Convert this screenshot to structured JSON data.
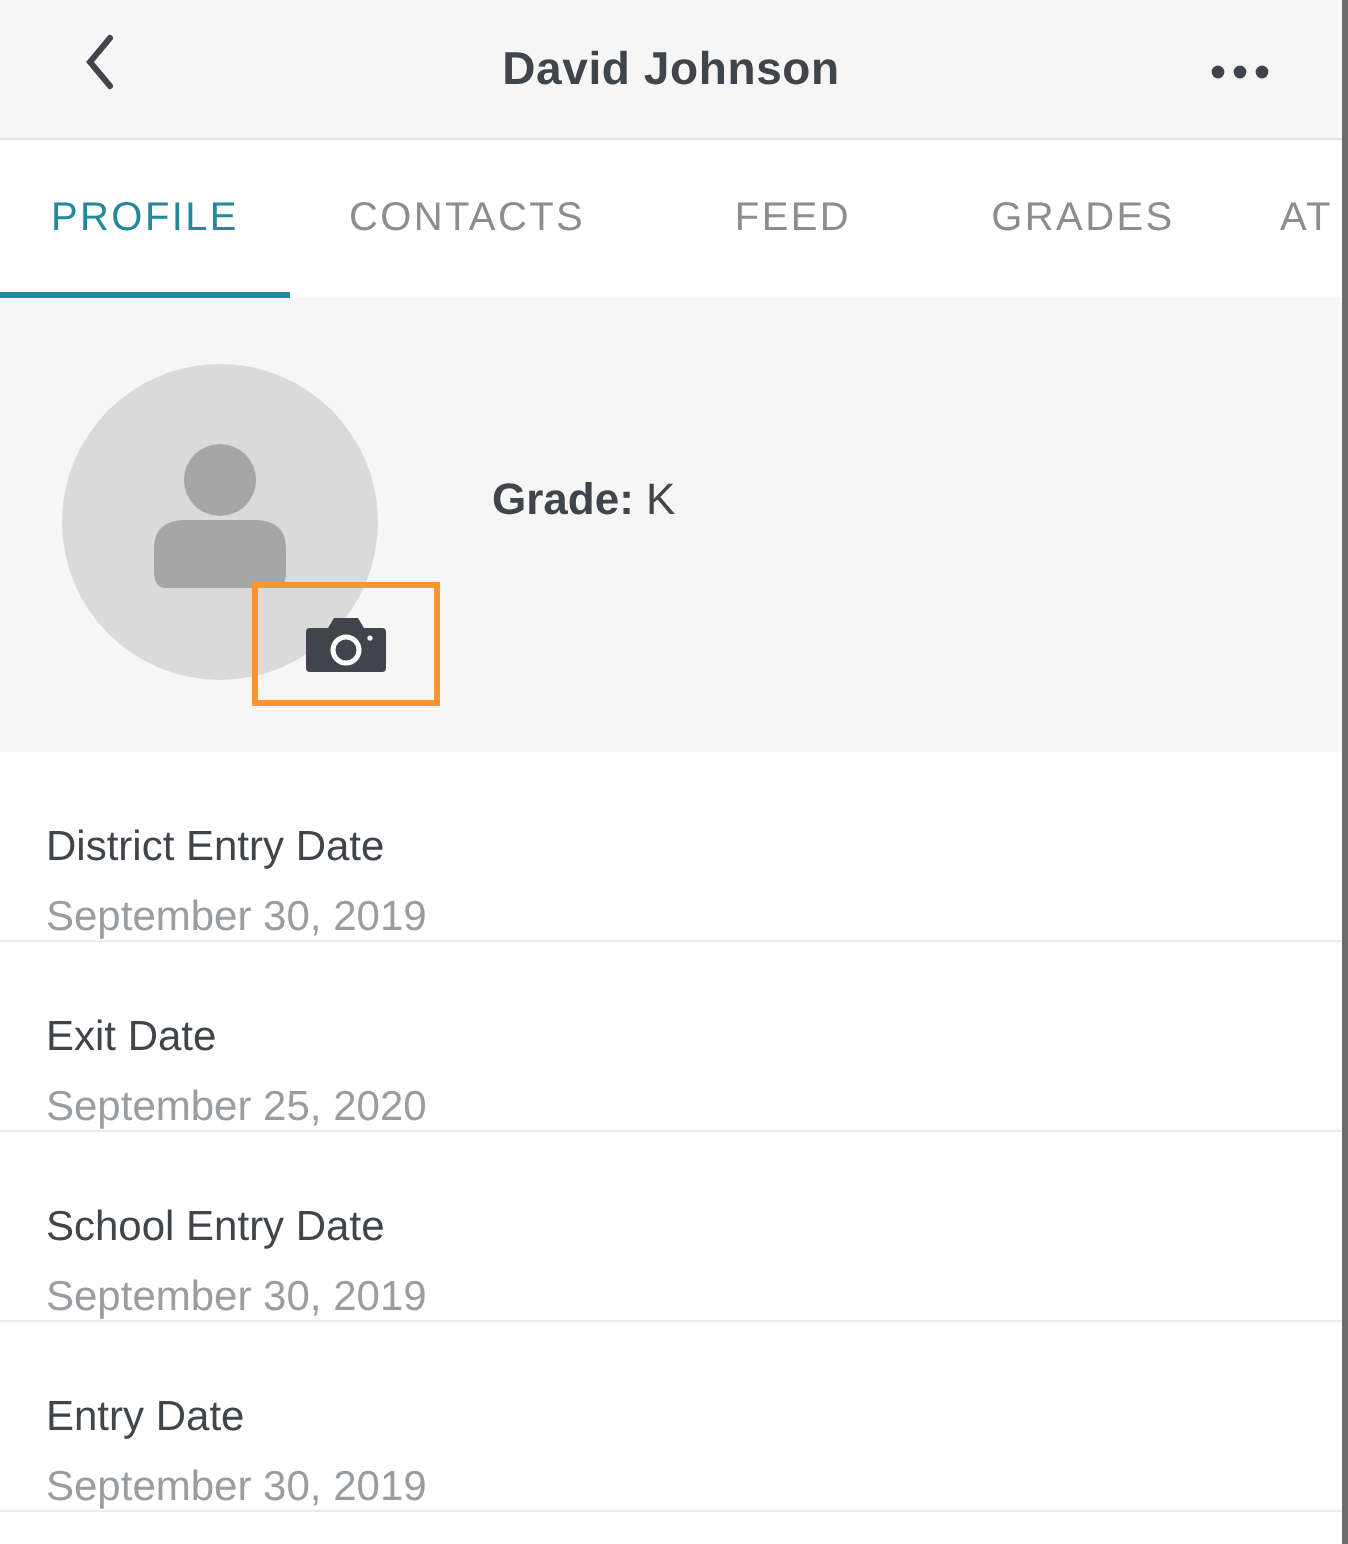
{
  "header": {
    "title": "David Johnson"
  },
  "tabs": [
    {
      "label": "PROFILE",
      "selected": true
    },
    {
      "label": "CONTACTS",
      "selected": false
    },
    {
      "label": "FEED",
      "selected": false
    },
    {
      "label": "GRADES",
      "selected": false
    },
    {
      "label": "AT",
      "selected": false
    }
  ],
  "profile": {
    "grade_label": "Grade:",
    "grade_value": "K",
    "camera_highlighted": true
  },
  "fields": [
    {
      "label": "District Entry Date",
      "value": "September 30, 2019"
    },
    {
      "label": "Exit Date",
      "value": "September 25, 2020"
    },
    {
      "label": "School Entry Date",
      "value": "September 30, 2019"
    },
    {
      "label": "Entry Date",
      "value": "September 30, 2019"
    }
  ]
}
